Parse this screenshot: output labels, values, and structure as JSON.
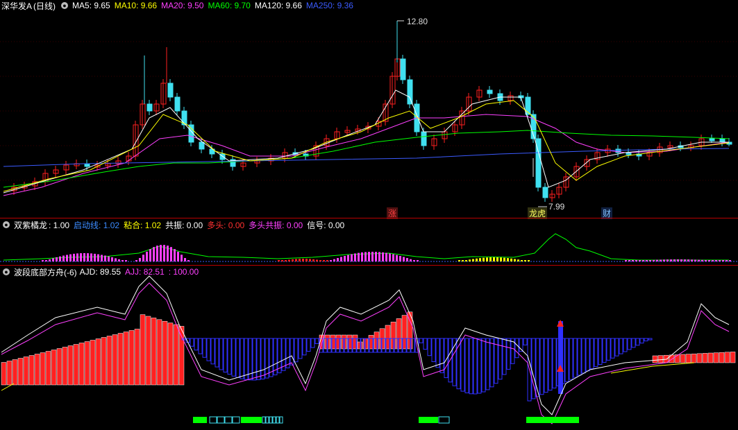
{
  "panel1": {
    "title": "深华发A",
    "period": "(日线)",
    "indicators": [
      {
        "label": "MA5: 9.65",
        "color": "#ffffff"
      },
      {
        "label": "MA10: 9.66",
        "color": "#ffff00"
      },
      {
        "label": "MA20: 9.50",
        "color": "#ff40ff"
      },
      {
        "label": "MA60: 9.70",
        "color": "#00ff00"
      },
      {
        "label": "MA120: 9.66",
        "color": "#ffffff"
      },
      {
        "label": "MA250: 9.36",
        "color": "#3b5bff"
      }
    ],
    "high_label": "12.80",
    "low_label": "7.99",
    "markers": [
      {
        "text": "涨",
        "color": "#ff4040",
        "bg": "#501010"
      },
      {
        "text": "龙虎",
        "color": "#ffff60",
        "bg": "#303010"
      },
      {
        "text": "财",
        "color": "#80c0ff",
        "bg": "#102040"
      }
    ]
  },
  "panel2": {
    "title": "双紫橘龙",
    "indicators": [
      {
        "label": ": 1.00",
        "color": "#ffffff"
      },
      {
        "label": "启动线: 1.02",
        "color": "#3b8bff"
      },
      {
        "label": "粘合: 1.02",
        "color": "#ffff00"
      },
      {
        "label": "共振: 0.00",
        "color": "#ffffff"
      },
      {
        "label": "多头: 0.00",
        "color": "#ff3030"
      },
      {
        "label": "多头共振: 0.00",
        "color": "#ff40ff"
      },
      {
        "label": "信号: 0.00",
        "color": "#ffffff"
      }
    ]
  },
  "panel3": {
    "title": "波段底部方舟(-6)",
    "indicators": [
      {
        "label": "AJD: 89.55",
        "color": "#ffffff"
      },
      {
        "label": "AJJ: 82.51",
        "color": "#ff40ff"
      },
      {
        "label": ": 100.00",
        "color": "#ff40ff"
      }
    ]
  },
  "colors": {
    "up": "#ff2020",
    "down": "#40e0f0",
    "grid": "#800000"
  }
}
